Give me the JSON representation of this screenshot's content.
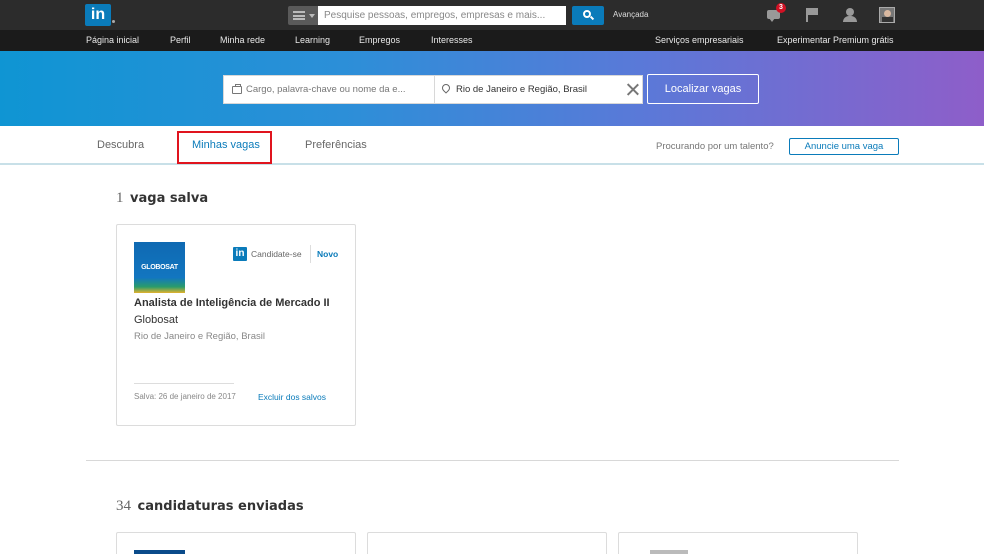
{
  "topbar": {
    "logo_text": "in",
    "search_placeholder": "Pesquise pessoas, empregos, empresas e mais...",
    "advanced_label": "Avançada",
    "messages_badge": "3"
  },
  "nav": {
    "items": [
      "Página inicial",
      "Perfil",
      "Minha rede",
      "Learning",
      "Empregos",
      "Interesses",
      "Serviços empresariais",
      "Experimentar Premium grátis"
    ]
  },
  "hero": {
    "keyword_placeholder": "Cargo, palavra-chave ou nome da e...",
    "location_value": "Rio de Janeiro e Região, Brasil",
    "find_button": "Localizar vagas"
  },
  "tabs": {
    "items": [
      "Descubra",
      "Minhas vagas",
      "Preferências"
    ],
    "active": "Minhas vagas",
    "talent_text": "Procurando por um talento?",
    "post_job_button": "Anuncie uma vaga"
  },
  "saved_jobs": {
    "count": "1",
    "label": "vaga salva",
    "jobs": [
      {
        "logo_text": "GLOBOSAT",
        "apply_label": "Candidate-se",
        "badge": "Novo",
        "title": "Analista de Inteligência de Mercado II",
        "company": "Globosat",
        "location": "Rio de Janeiro e Região, Brasil",
        "saved_date": "Salva: 26 de janeiro de 2017",
        "remove_label": "Excluir dos salvos"
      }
    ]
  },
  "applications": {
    "count": "34",
    "label": "candidaturas enviadas"
  },
  "colors": {
    "brand": "#0a7bba",
    "topbar": "#2c2c2c",
    "navbar": "#1b1b1b",
    "highlight": "#e0141e",
    "badge": "#d11124"
  }
}
